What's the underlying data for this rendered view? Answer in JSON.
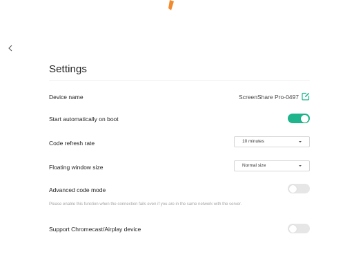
{
  "header": {
    "back_icon": "chevron-left-icon",
    "title": "Settings"
  },
  "settings": {
    "device_name": {
      "label": "Device name",
      "value": "ScreenShare Pro-0497",
      "edit_icon": "edit-icon"
    },
    "start_on_boot": {
      "label": "Start automatically on boot",
      "enabled": true
    },
    "code_refresh_rate": {
      "label": "Code refresh rate",
      "selected": "10 minutes"
    },
    "floating_window_size": {
      "label": "Floating window size",
      "selected": "Normal size"
    },
    "advanced_code_mode": {
      "label": "Advanced code mode",
      "enabled": false,
      "hint": "Please enable this function when the connection fails even if you are in the same network with the server."
    },
    "chromecast_airplay": {
      "label": "Support Chromecast/Airplay device",
      "enabled": false
    }
  },
  "colors": {
    "accent": "#1fb48c",
    "toggle_off": "#e6e6e6",
    "top_mark": "#f28a2e"
  }
}
